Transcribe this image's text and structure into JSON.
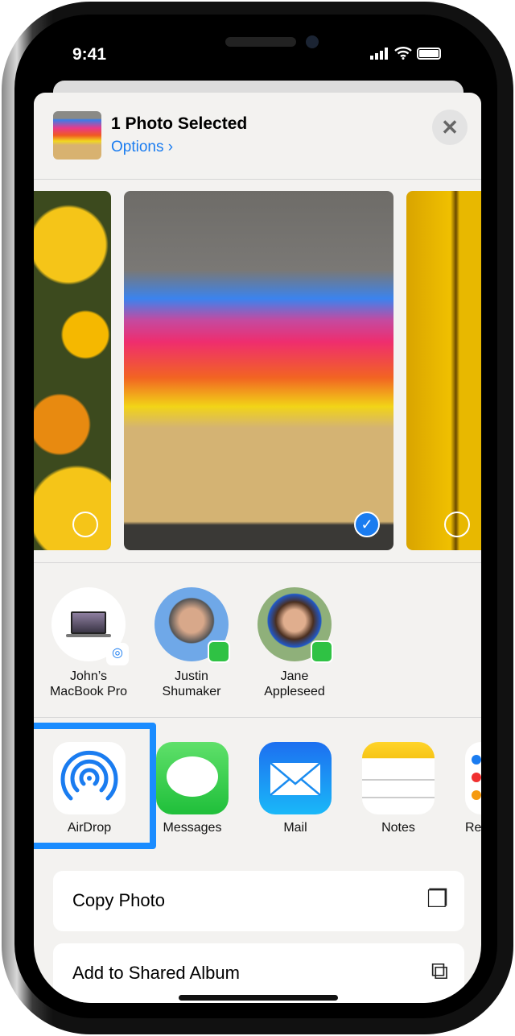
{
  "status_bar": {
    "time": "9:41",
    "icons": [
      "cellular-signal-icon",
      "wifi-icon",
      "battery-icon"
    ]
  },
  "header": {
    "title": "1 Photo Selected",
    "options_label": "Options",
    "options_chevron": "›",
    "close_icon": "✕"
  },
  "photos": [
    {
      "selected": false
    },
    {
      "selected": true,
      "check": "✓"
    },
    {
      "selected": false
    }
  ],
  "people": [
    {
      "name_line1": "John’s",
      "name_line2": "MacBook Pro",
      "badge": "airdrop-icon"
    },
    {
      "name_line1": "Justin",
      "name_line2": "Shumaker",
      "badge": "messages-icon"
    },
    {
      "name_line1": "Jane",
      "name_line2": "Appleseed",
      "badge": "messages-icon"
    }
  ],
  "apps": [
    {
      "label": "AirDrop"
    },
    {
      "label": "Messages"
    },
    {
      "label": "Mail"
    },
    {
      "label": "Notes"
    },
    {
      "label": "Re"
    }
  ],
  "actions": [
    {
      "label": "Copy Photo",
      "icon": "copy-icon"
    },
    {
      "label": "Add to Shared Album",
      "icon": "shared-album-icon"
    }
  ],
  "colors": {
    "accent": "#1a7cf0",
    "highlight": "#1a8cff",
    "sheet": "#f3f2f0"
  }
}
